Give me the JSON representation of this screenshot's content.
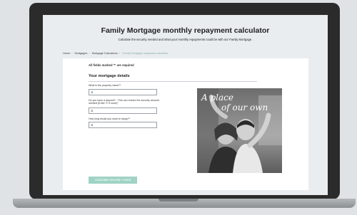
{
  "page": {
    "title": "Family Mortgage monthly repayment calculator",
    "subtitle": "Calculate the security needed and what your monthly repayments could be with our Family Mortgage."
  },
  "breadcrumb": [
    "Home",
    "Mortgages",
    "Mortgage Calculators",
    "Family Mortgage repayment calculator"
  ],
  "form": {
    "required_note": "All fields marked '*' are required",
    "section_title": "Your mortgage details",
    "fields": [
      {
        "label": "What is the property value?*",
        "value": "£"
      },
      {
        "label": "Do you have a deposit? - This can reduce the security amount needed (Enter '0' if none)*",
        "value": "£"
      },
      {
        "label": "How long would you want to repay?*",
        "value": "£"
      }
    ],
    "submit_label": "Calculate security I need"
  },
  "photo": {
    "caption_line1": "A place",
    "caption_line2": "of our own"
  }
}
